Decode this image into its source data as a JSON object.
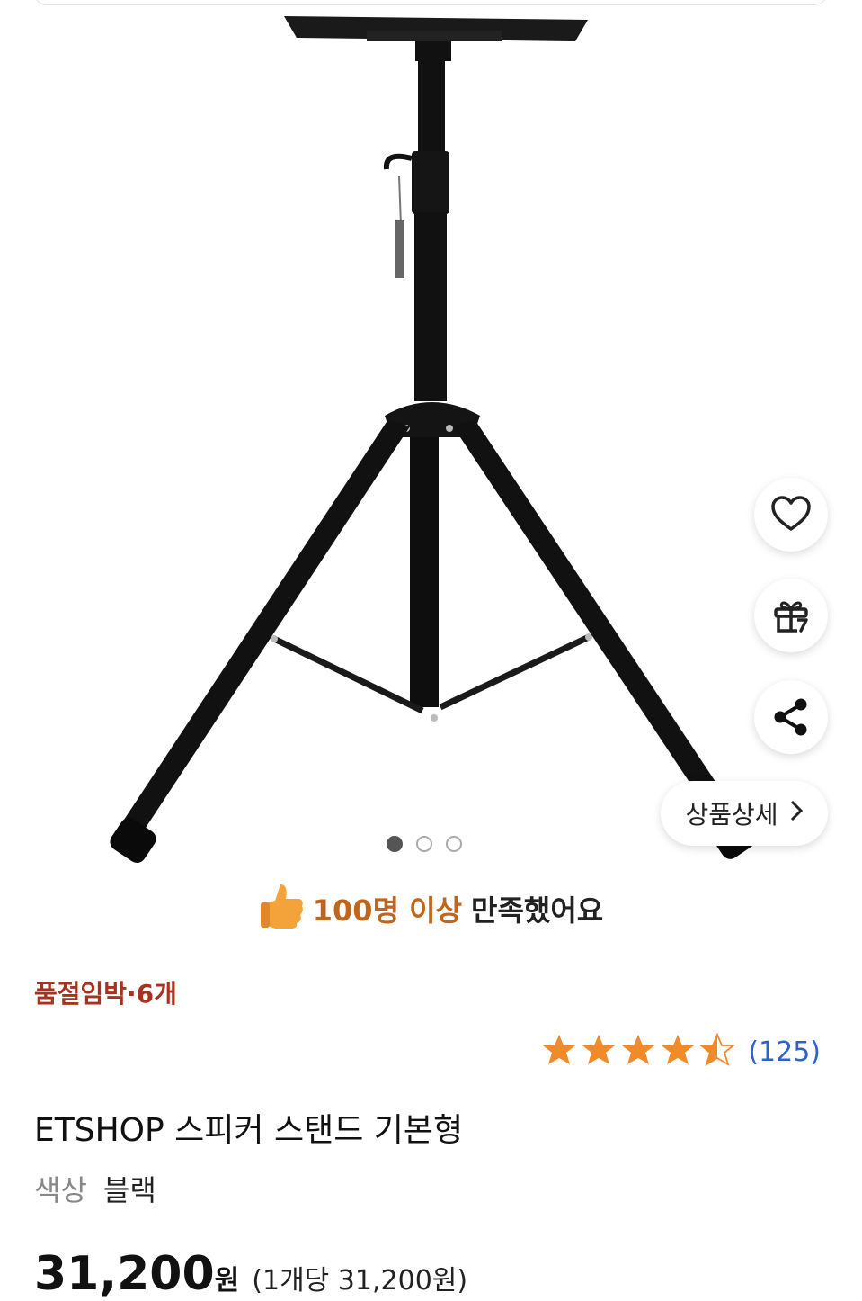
{
  "product_image": {
    "alt": "ETSHOP 스피커 스탠드 기본형"
  },
  "actions": {
    "like_icon": "heart-icon",
    "gift_icon": "gift-icon",
    "share_icon": "share-icon"
  },
  "detail_button": {
    "label": "상품상세",
    "icon": "chevron-right-icon"
  },
  "carousel": {
    "total": 3,
    "active_index": 0
  },
  "satisfaction": {
    "highlight": "100명 이상",
    "rest": "만족했어요",
    "icon": "thumbs-up-icon"
  },
  "stock": {
    "label": "품절임박·6개"
  },
  "rating": {
    "value": 4.5,
    "max": 5,
    "count": "(125)",
    "star_color": "#f08a2a"
  },
  "product": {
    "title": "ETSHOP 스피커 스탠드 기본형"
  },
  "option": {
    "label": "색상",
    "value": "블랙"
  },
  "price": {
    "value": "31,200",
    "unit": "원",
    "unit_price": "(1개당 31,200원)"
  },
  "colors": {
    "accent": "#c0651a",
    "warning": "#a8321e",
    "link": "#2c63c9"
  }
}
